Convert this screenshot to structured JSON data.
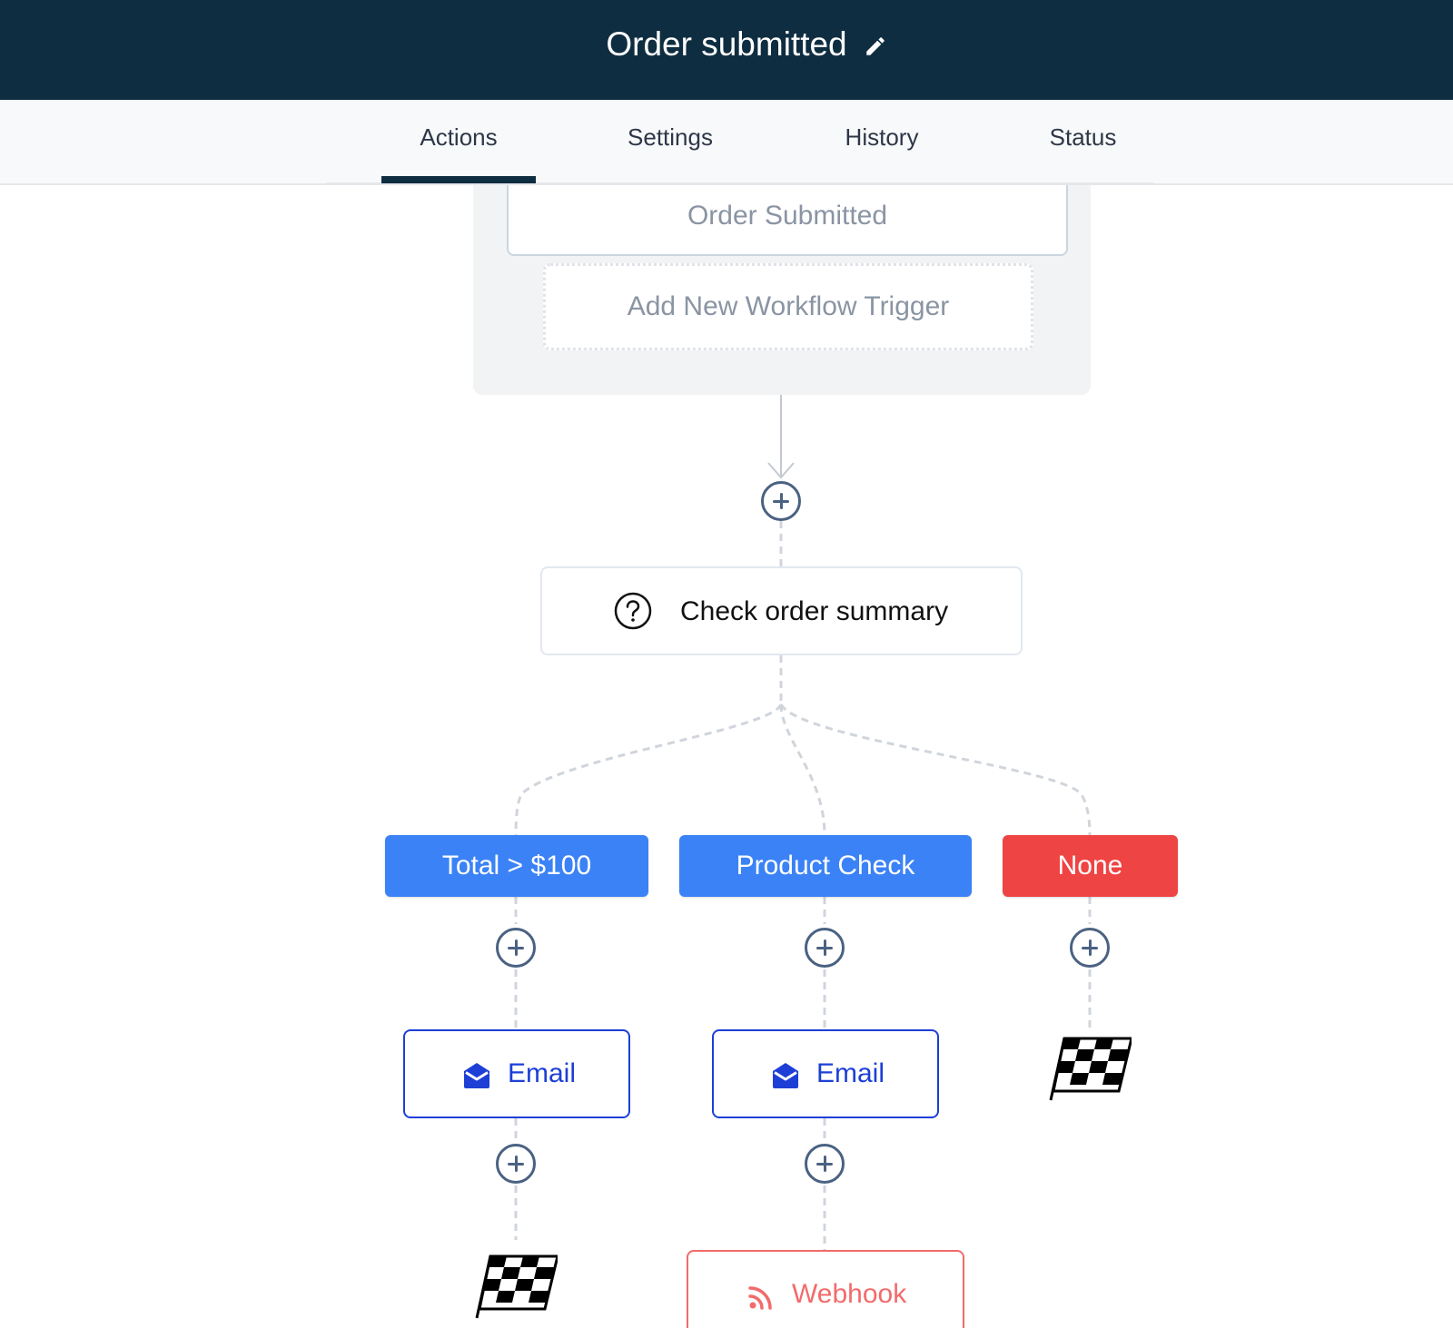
{
  "header": {
    "title": "Order submitted",
    "edit_icon": "pencil-icon"
  },
  "tabs": [
    {
      "label": "Actions",
      "active": true
    },
    {
      "label": "Settings",
      "active": false
    },
    {
      "label": "History",
      "active": false
    },
    {
      "label": "Status",
      "active": false
    }
  ],
  "trigger_panel": {
    "trigger": "Order Submitted",
    "add_trigger_label": "Add New Workflow Trigger"
  },
  "condition": {
    "label": "Check order summary",
    "icon": "question-circle-icon"
  },
  "branches": [
    {
      "label": "Total > $100",
      "color": "#3b82f6",
      "action": "Email",
      "action_icon": "envelope-icon",
      "end": "checkered-flag-icon"
    },
    {
      "label": "Product Check",
      "color": "#3b82f6",
      "action": "Email",
      "action_icon": "envelope-icon",
      "next_action": "Webhook",
      "next_action_icon": "rss-icon"
    },
    {
      "label": "None",
      "color": "#ef4444",
      "end": "checkered-flag-icon"
    }
  ],
  "colors": {
    "header_bg": "#0f2d40",
    "branch_blue": "#3b82f6",
    "branch_red": "#ef4444",
    "action_border": "#1d3fd6",
    "webhook": "#f26b6b"
  }
}
